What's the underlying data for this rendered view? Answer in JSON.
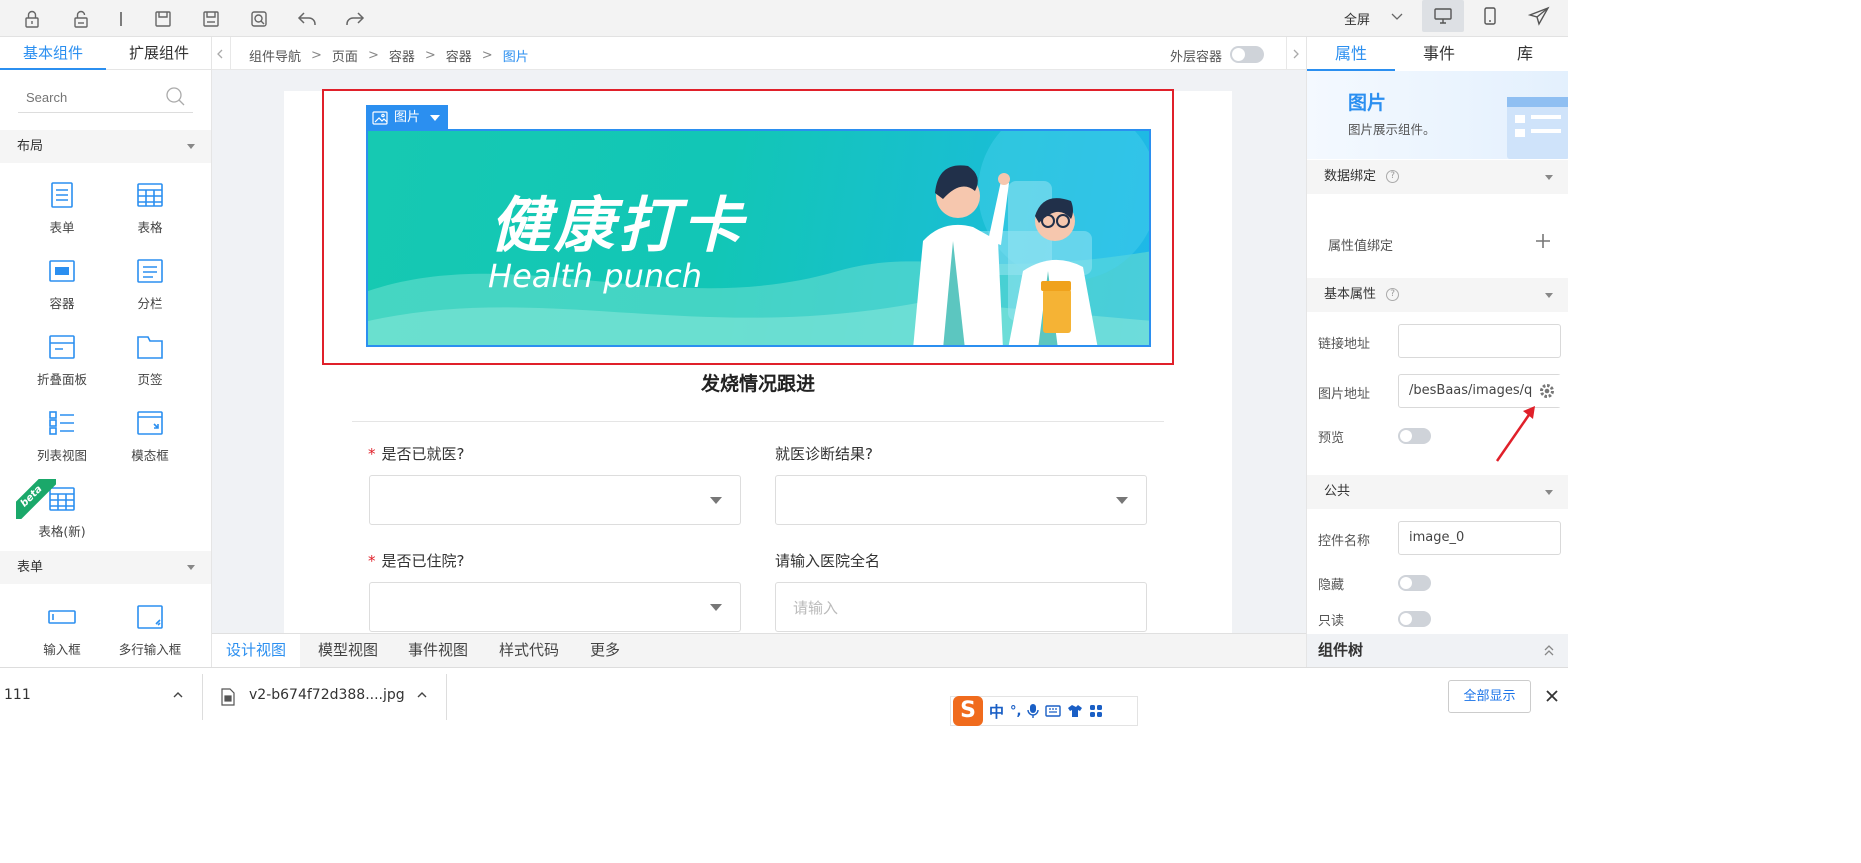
{
  "toolbar": {
    "fullscreen_label": "全屏",
    "icons": [
      "lock-icon",
      "unlock-icon",
      "divider",
      "save-icon",
      "save-as-icon",
      "preview-icon",
      "undo-icon",
      "redo-icon"
    ]
  },
  "left_panel": {
    "tabs": [
      "基本组件",
      "扩展组件"
    ],
    "search_placeholder": "Search",
    "sections": [
      {
        "title": "布局",
        "items": [
          {
            "label": "表单",
            "icon": "form-icon"
          },
          {
            "label": "表格",
            "icon": "table-icon"
          },
          {
            "label": "容器",
            "icon": "container-icon"
          },
          {
            "label": "分栏",
            "icon": "columns-icon"
          },
          {
            "label": "折叠面板",
            "icon": "collapse-icon"
          },
          {
            "label": "页签",
            "icon": "tabs-icon"
          },
          {
            "label": "列表视图",
            "icon": "list-view-icon"
          },
          {
            "label": "模态框",
            "icon": "modal-icon"
          },
          {
            "label": "表格(新)",
            "icon": "table-new-icon",
            "badge": "beta"
          }
        ]
      },
      {
        "title": "表单",
        "items": [
          {
            "label": "输入框",
            "icon": "input-icon"
          },
          {
            "label": "多行输入框",
            "icon": "textarea-icon"
          }
        ]
      }
    ]
  },
  "breadcrumb": {
    "items": [
      "组件导航",
      "页面",
      "容器",
      "容器",
      "图片"
    ],
    "outer_container_label": "外层容器"
  },
  "canvas": {
    "image_tag_label": "图片",
    "banner": {
      "title_cn": "健康打卡",
      "title_en": "Health punch"
    },
    "form_title": "发烧情况跟进",
    "fields": [
      {
        "label": "是否已就医?",
        "required": true,
        "type": "select"
      },
      {
        "label": "就医诊断结果?",
        "required": false,
        "type": "select"
      },
      {
        "label": "是否已住院?",
        "required": true,
        "type": "select"
      },
      {
        "label": "请输入医院全名",
        "required": false,
        "type": "input",
        "placeholder": "请输入"
      }
    ]
  },
  "view_tabs": {
    "items": [
      "设计视图",
      "模型视图",
      "事件视图",
      "样式代码",
      "更多"
    ],
    "active": 0
  },
  "right_panel": {
    "tabs": [
      "属性",
      "事件",
      "库"
    ],
    "component_title": "图片",
    "component_desc": "图片展示组件。",
    "sections": {
      "data_binding": "数据绑定",
      "property_binding": "属性值绑定",
      "basic": "基本属性",
      "common": "公共",
      "tree": "组件树"
    },
    "link_label": "链接地址",
    "link_value": "",
    "image_url_label": "图片地址",
    "image_url_value": "/besBaas/images/qui",
    "preview_label": "预览",
    "control_name_label": "控件名称",
    "control_name_value": "image_0",
    "hidden_label": "隐藏",
    "readonly_label": "只读"
  },
  "download_bar": {
    "left_text": "111",
    "file_name": "v2-b674f72d388....jpg",
    "show_all_label": "全部显示"
  },
  "ime": {
    "lang": "中",
    "punct": "°,"
  },
  "colors": {
    "accent": "#2b8ff0",
    "selection": "#e0202a",
    "annotation_arrow": "#e0202a",
    "banner_start": "#16c9b2",
    "banner_end": "#1fb8e9"
  }
}
